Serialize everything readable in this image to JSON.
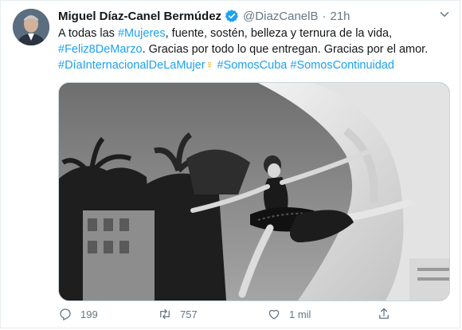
{
  "tweet": {
    "author_name": "Miguel Díaz-Canel Bermúdez",
    "author_handle": "@DiazCanelB",
    "separator": "·",
    "time": "21h",
    "text_parts": {
      "t1": "A todas  las ",
      "h1": "#Mujeres",
      "t2": ", fuente, sostén, belleza y ternura de la vida, ",
      "h2": "#Feliz8DeMarzo",
      "t3": ". Gracias por todo lo que entregan. Gracias por el amor. ",
      "h3": "#DíaInternacionalDeLaMujer",
      "emoji": "♀",
      "h4": "#SomosCuba",
      "h5": "#SomosContinuidad"
    },
    "actions": {
      "reply_count": "199",
      "retweet_count": "757",
      "like_count": "1 mil"
    }
  },
  "icons": {
    "verified": "verified-badge-icon",
    "menu": "chevron-down-icon",
    "reply": "reply-icon",
    "retweet": "retweet-icon",
    "like": "heart-icon",
    "share": "share-icon"
  },
  "colors": {
    "link": "#1da1f2",
    "muted": "#657786",
    "text": "#14171a",
    "border": "#e6ecf0"
  }
}
